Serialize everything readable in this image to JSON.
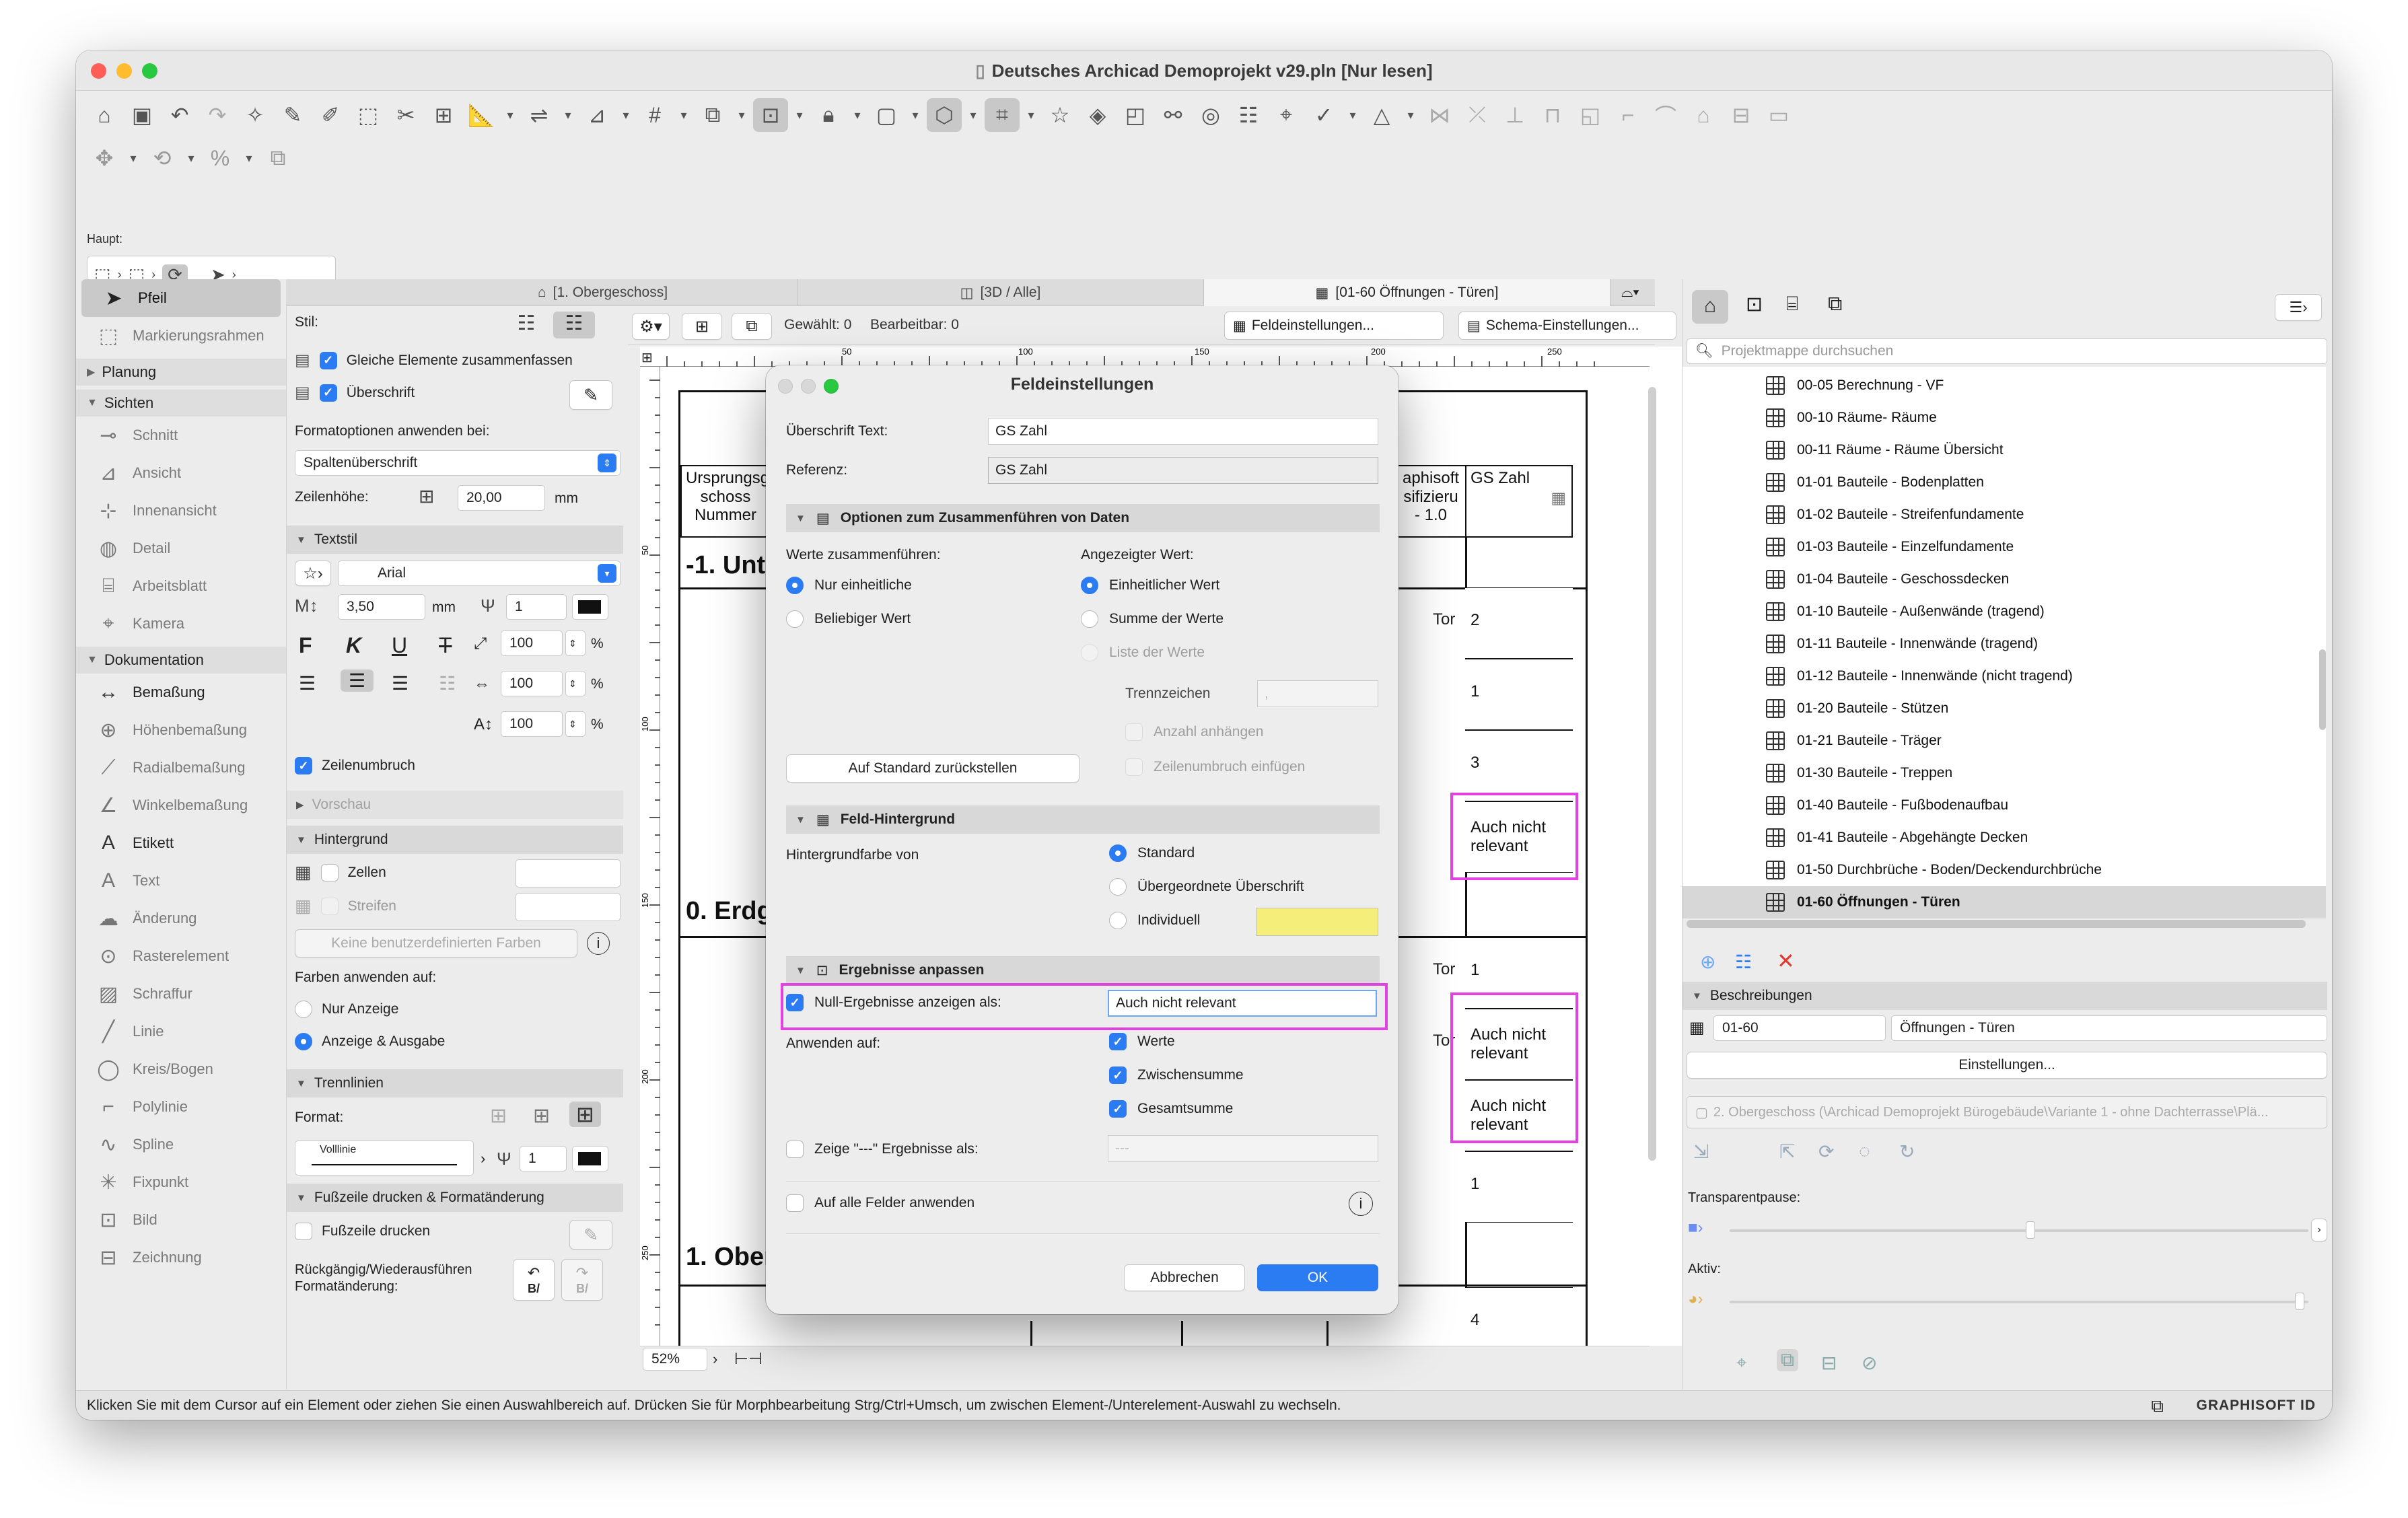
{
  "window": {
    "title": "Deutsches Archicad Demoprojekt v29.pln [Nur lesen]"
  },
  "toolbar": {
    "section_label": "Haupt:"
  },
  "toolbox": {
    "items": [
      {
        "kind": "tool",
        "label": "Pfeil",
        "icon": "arrow-icon",
        "selected": true
      },
      {
        "kind": "tool",
        "label": "Markierungsrahmen",
        "icon": "marquee-icon"
      },
      {
        "kind": "group",
        "label": "Planung",
        "collapsed": true
      },
      {
        "kind": "group",
        "label": "Sichten",
        "collapsed": false
      },
      {
        "kind": "tool",
        "label": "Schnitt",
        "icon": "section-icon"
      },
      {
        "kind": "tool",
        "label": "Ansicht",
        "icon": "elevation-icon"
      },
      {
        "kind": "tool",
        "label": "Innenansicht",
        "icon": "interior-elevation-icon"
      },
      {
        "kind": "tool",
        "label": "Detail",
        "icon": "detail-icon"
      },
      {
        "kind": "tool",
        "label": "Arbeitsblatt",
        "icon": "worksheet-icon"
      },
      {
        "kind": "tool",
        "label": "Kamera",
        "icon": "camera-icon"
      },
      {
        "kind": "group",
        "label": "Dokumentation",
        "collapsed": false
      },
      {
        "kind": "tool",
        "label": "Bemaßung",
        "icon": "dimension-icon",
        "dark": true
      },
      {
        "kind": "tool",
        "label": "Höhenbemaßung",
        "icon": "level-dimension-icon"
      },
      {
        "kind": "tool",
        "label": "Radialbemaßung",
        "icon": "radial-dimension-icon"
      },
      {
        "kind": "tool",
        "label": "Winkelbemaßung",
        "icon": "angle-dimension-icon"
      },
      {
        "kind": "tool",
        "label": "Etikett",
        "icon": "label-icon",
        "dark": true
      },
      {
        "kind": "tool",
        "label": "Text",
        "icon": "text-icon"
      },
      {
        "kind": "tool",
        "label": "Änderung",
        "icon": "change-icon"
      },
      {
        "kind": "tool",
        "label": "Rasterelement",
        "icon": "grid-element-icon"
      },
      {
        "kind": "tool",
        "label": "Schraffur",
        "icon": "fill-icon"
      },
      {
        "kind": "tool",
        "label": "Linie",
        "icon": "line-icon"
      },
      {
        "kind": "tool",
        "label": "Kreis/Bogen",
        "icon": "arc-icon"
      },
      {
        "kind": "tool",
        "label": "Polylinie",
        "icon": "polyline-icon"
      },
      {
        "kind": "tool",
        "label": "Spline",
        "icon": "spline-icon"
      },
      {
        "kind": "tool",
        "label": "Fixpunkt",
        "icon": "hotspot-icon"
      },
      {
        "kind": "tool",
        "label": "Bild",
        "icon": "image-icon"
      },
      {
        "kind": "tool",
        "label": "Zeichnung",
        "icon": "drawing-icon"
      }
    ]
  },
  "infobox": {
    "stil_label": "Stil:",
    "merge_same": "Gleiche Elemente zusammenfassen",
    "header_label": "Überschrift",
    "format_apply_label": "Formatoptionen anwenden bei:",
    "format_apply_value": "Spaltenüberschrift",
    "row_height_label": "Zeilenhöhe:",
    "row_height_value": "20,00",
    "row_height_unit": "mm",
    "textstil_section": "Textstil",
    "font_value": "Arial",
    "font_size": "3,50",
    "font_size_unit": "mm",
    "pen_value": "1",
    "width_pct": "100",
    "spacing_pct": "100",
    "height_pct": "100",
    "pct": "%",
    "wrap_label": "Zeilenumbruch",
    "vorschau_section": "Vorschau",
    "hintergrund_section": "Hintergrund",
    "cells_label": "Zellen",
    "stripes_label": "Streifen",
    "no_custom_colors": "Keine benutzerdefinierten Farben",
    "colors_apply_label": "Farben anwenden auf:",
    "only_display": "Nur Anzeige",
    "display_output": "Anzeige & Ausgabe",
    "trennlinien_section": "Trennlinien",
    "format_label": "Format:",
    "line_type": "Volllinie",
    "line_pen": "1",
    "footer_section": "Fußzeile drucken & Formatänderung",
    "footer_label": "Fußzeile drucken",
    "undo_label": "Rückgängig/Wiederausführen Formatänderung:",
    "undo_btn": "B/",
    "redo_btn": "B/"
  },
  "tabs": [
    {
      "label": "[1. Obergeschoss]",
      "icon": "floorplan-icon"
    },
    {
      "label": "[3D / Alle]",
      "icon": "3d-icon"
    },
    {
      "label": "[01-60 Öffnungen - Türen]",
      "icon": "schedule-icon",
      "active": true
    }
  ],
  "context": {
    "selected_text": "Gewählt: 0",
    "editable_text": "Bearbeitbar: 0",
    "field_settings_btn": "Feldeinstellungen...",
    "scheme_settings_btn": "Schema-Einstellungen..."
  },
  "ruler": {
    "h_ticks": [
      "50",
      "100",
      "150",
      "200",
      "250"
    ],
    "v_ticks": [
      "50",
      "100",
      "150",
      "200",
      "250"
    ]
  },
  "schedule": {
    "header_cells": [
      "Ursprungsg schoss Nummer",
      "aphisoft sifiziеru - 1.0",
      "GS Zahl"
    ],
    "floor_labels": [
      "-1. Unte",
      "0. Erdg",
      "1. Ober"
    ],
    "tor_labels": [
      "Tor",
      "Tor",
      "Tor"
    ],
    "values": [
      "2",
      "1",
      "3",
      "1",
      "1",
      "4"
    ],
    "null_text": "Auch nicht relevant"
  },
  "zoom": {
    "value": "52%"
  },
  "dialog": {
    "title": "Feldeinstellungen",
    "header_text_label": "Überschrift Text:",
    "header_text_value": "GS Zahl",
    "reference_label": "Referenz:",
    "reference_value": "GS Zahl",
    "merge_section": "Optionen zum Zusammenführen von Daten",
    "merge_values_label": "Werte zusammenführen:",
    "only_uniform": "Nur einheitliche",
    "any_value": "Beliebiger Wert",
    "shown_value_label": "Angezeigter Wert:",
    "uniform_value": "Einheitlicher Wert",
    "sum_values": "Summe der Werte",
    "list_values": "Liste der Werte",
    "separator_label": "Trennzeichen",
    "separator_value": ",",
    "append_count": "Anzahl anhängen",
    "insert_linebreak": "Zeilenumbruch einfügen",
    "reset_btn": "Auf Standard zurückstellen",
    "background_section": "Feld-Hintergrund",
    "bg_color_label": "Hintergrundfarbe von",
    "bg_standard": "Standard",
    "bg_parent": "Übergeordnete Überschrift",
    "bg_individual": "Individuell",
    "bg_swatch": "#f5ee7a",
    "results_section": "Ergebnisse anpassen",
    "null_results_label": "Null-Ergebnisse anzeigen als:",
    "null_results_value": "Auch nicht relevant",
    "apply_to_label": "Anwenden auf:",
    "apply_values": "Werte",
    "apply_subtotal": "Zwischensumme",
    "apply_total": "Gesamtsumme",
    "dash_results_label": "Zeige \"---\" Ergebnisse als:",
    "dash_results_value": "---",
    "apply_all_fields": "Auf alle Felder anwenden",
    "cancel_btn": "Abbrechen",
    "ok_btn": "OK"
  },
  "navigator": {
    "search_placeholder": "Projektmappe durchsuchen",
    "items": [
      "00-05 Berechnung - VF",
      "00-10 Räume- Räume",
      "00-11 Räume - Räume Übersicht",
      "01-01 Bauteile - Bodenplatten",
      "01-02 Bauteile - Streifenfundamente",
      "01-03 Bauteile - Einzelfundamente",
      "01-04 Bauteile - Geschossdecken",
      "01-10 Bauteile - Außenwände (tragend)",
      "01-11 Bauteile - Innenwände (tragend)",
      "01-12 Bauteile - Innenwände (nicht tragend)",
      "01-20 Bauteile - Stützen",
      "01-21 Bauteile - Träger",
      "01-30 Bauteile - Treppen",
      "01-40 Bauteile - Fußbodenaufbau",
      "01-41 Bauteile - Abgehängte Decken",
      "01-50 Durchbrüche - Boden/Deckendurchbrüche",
      "01-60 Öffnungen - Türen"
    ],
    "selected_index": 16
  },
  "properties": {
    "section": "Beschreibungen",
    "id_value": "01-60",
    "name_value": "Öffnungen - Türen",
    "settings_btn": "Einstellungen...",
    "path_value": "2. Obergeschoss (\\Archicad Demoprojekt Bürogebäude\\Variante 1 - ohne Dachterrasse\\Plä...",
    "transparency_label": "Transparentpause:",
    "active_label": "Aktiv:"
  },
  "status": {
    "text": "Klicken Sie mit dem Cursor auf ein Element oder ziehen Sie einen Auswahlbereich auf. Drücken Sie für Morphbearbeitung Strg/Ctrl+Umsch, um zwischen Element-/Unterelement-Auswahl zu wechseln.",
    "brand": "GRAPHISOFT ID"
  },
  "colors": {
    "accent": "#2b7bf3",
    "highlight": "#e243e0",
    "close": "#ff5f57",
    "minimize": "#febc2e",
    "zoom": "#28c840"
  }
}
